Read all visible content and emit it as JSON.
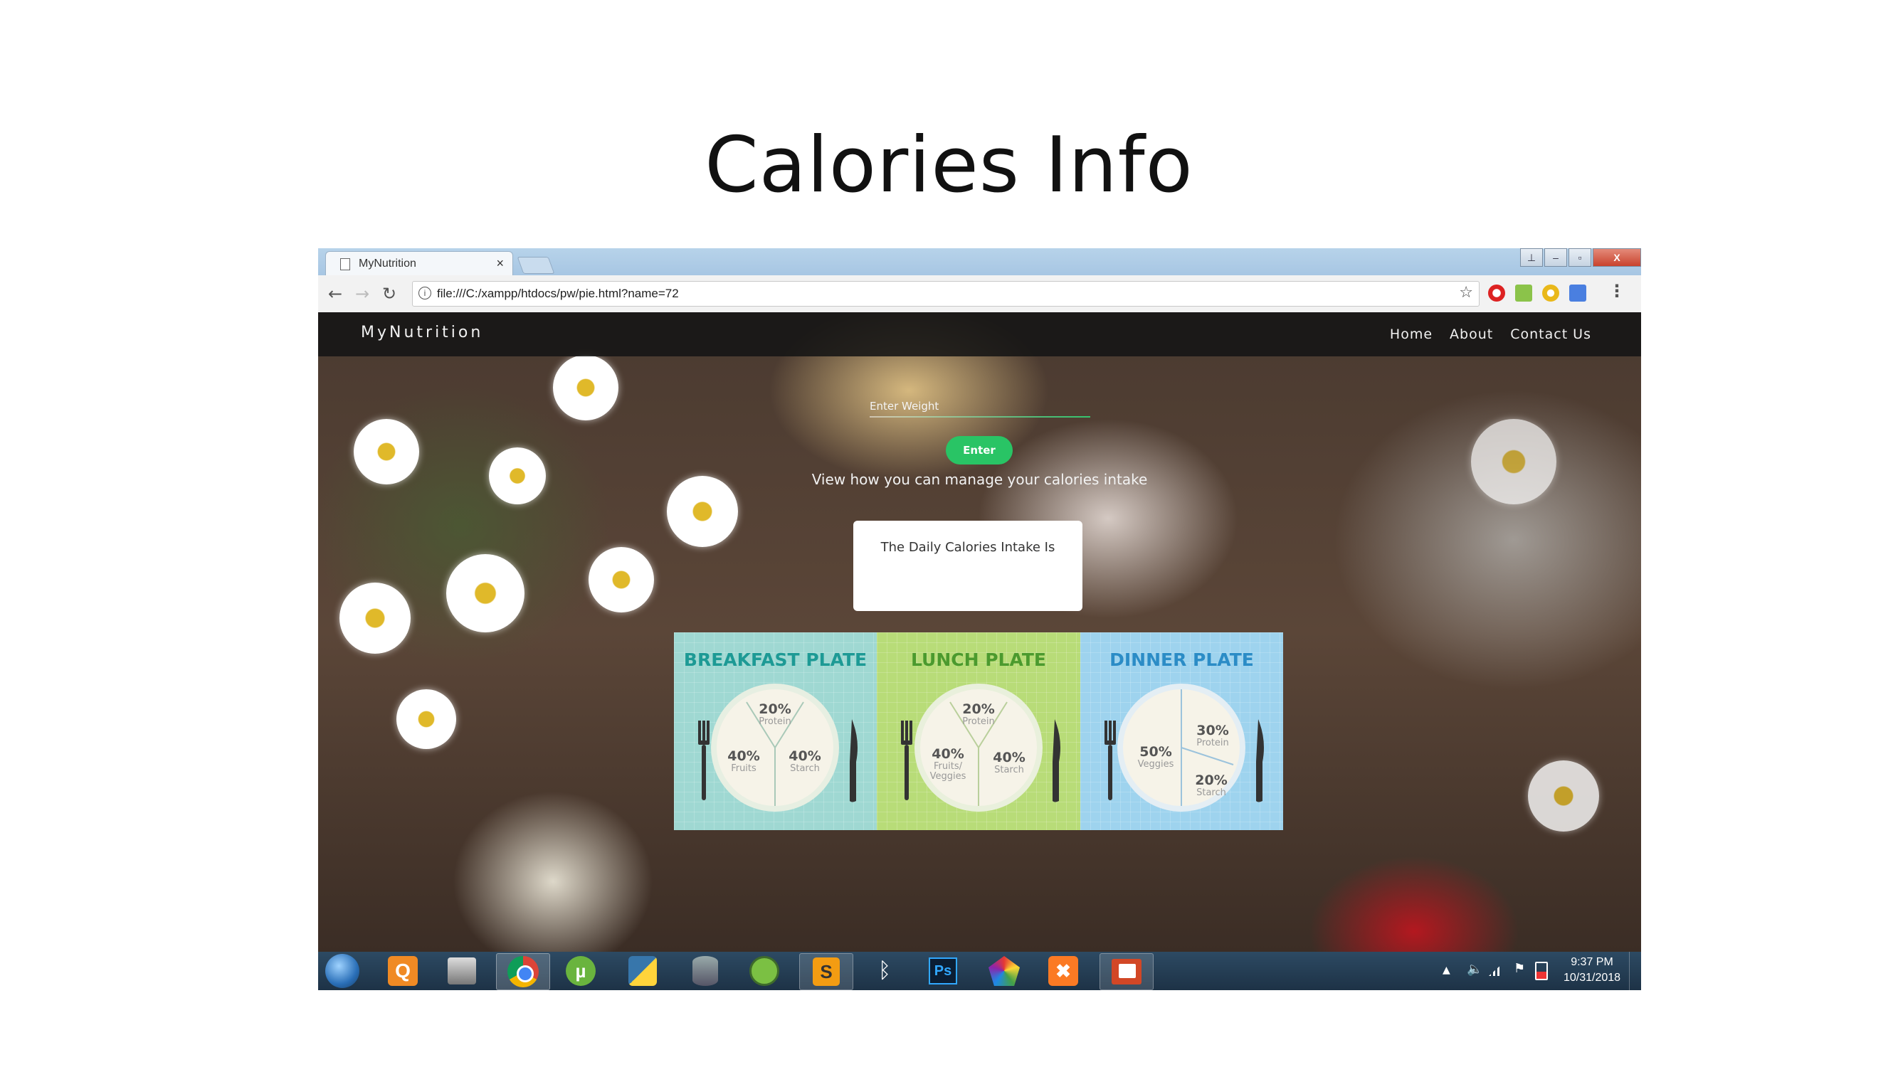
{
  "slide": {
    "title": "Calories Info"
  },
  "browser": {
    "tab_title": "MyNutrition",
    "tab_close": "×",
    "url": "file:///C:/xampp/htdocs/pw/pie.html?name=72",
    "window_buttons": [
      "",
      "–",
      "▫",
      "X"
    ]
  },
  "site": {
    "brand": "MyNutrition",
    "nav": [
      "Home",
      "About",
      "Contact Us"
    ],
    "weight_label": "Enter Weight",
    "enter_button": "Enter",
    "manage_text": "View how you can manage your calories intake",
    "intake_text": "The Daily Calories Intake Is"
  },
  "plates": [
    {
      "title": "BREAKFAST PLATE",
      "sections": [
        {
          "pct": "20%",
          "label": "Protein"
        },
        {
          "pct": "40%",
          "label": "Fruits"
        },
        {
          "pct": "40%",
          "label": "Starch"
        }
      ]
    },
    {
      "title": "LUNCH PLATE",
      "sections": [
        {
          "pct": "20%",
          "label": "Protein"
        },
        {
          "pct": "40%",
          "label": "Fruits/",
          "label2": "Veggies"
        },
        {
          "pct": "40%",
          "label": "Starch"
        }
      ]
    },
    {
      "title": "DINNER PLATE",
      "sections": [
        {
          "pct": "30%",
          "label": "Protein"
        },
        {
          "pct": "50%",
          "label": "Veggies"
        },
        {
          "pct": "20%",
          "label": "Starch"
        }
      ]
    }
  ],
  "taskbar": {
    "time": "9:37 PM",
    "date": "10/31/2018",
    "apps": [
      "windows-start",
      "q-app",
      "network-app",
      "chrome",
      "utorrent",
      "python",
      "database",
      "android-studio",
      "sublime",
      "bluetooth",
      "photoshop",
      "gem-app",
      "xampp",
      "presentation"
    ]
  }
}
